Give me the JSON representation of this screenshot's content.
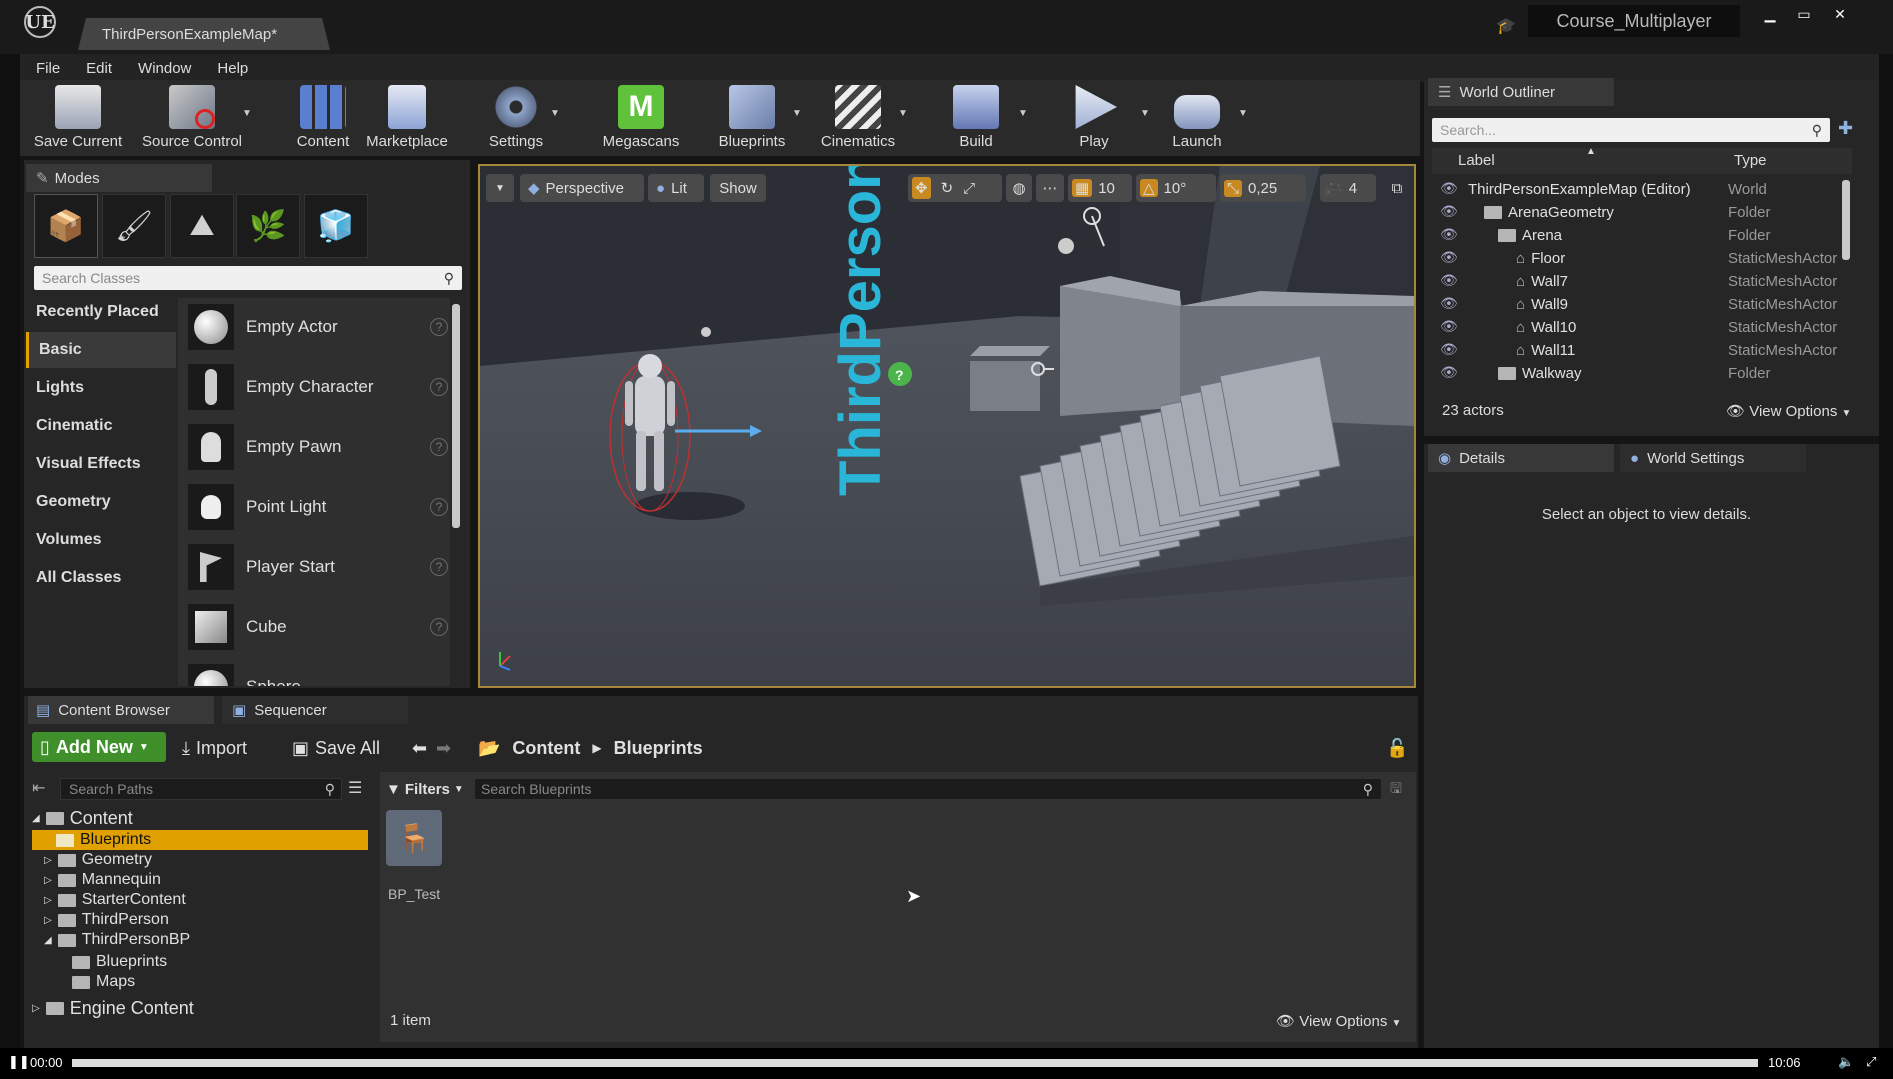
{
  "window": {
    "tab_title": "ThirdPersonExampleMap*",
    "project_name": "Course_Multiplayer",
    "logo": "UE"
  },
  "menu": [
    "File",
    "Edit",
    "Window",
    "Help"
  ],
  "toolbar": {
    "items": [
      "Save Current",
      "Source Control",
      "Content",
      "Marketplace",
      "Settings",
      "Megascans",
      "Blueprints",
      "Cinematics",
      "Build",
      "Play",
      "Launch"
    ]
  },
  "modes": {
    "tab": "Modes",
    "search_placeholder": "Search Classes",
    "categories": [
      "Recently Placed",
      "Basic",
      "Lights",
      "Cinematic",
      "Visual Effects",
      "Geometry",
      "Volumes",
      "All Classes"
    ],
    "active_category": "Basic",
    "classes": [
      "Empty Actor",
      "Empty Character",
      "Empty Pawn",
      "Point Light",
      "Player Start",
      "Cube",
      "Sphere"
    ]
  },
  "viewport": {
    "perspective": "Perspective",
    "lit": "Lit",
    "show": "Show",
    "grid_snap": "10",
    "rotation_snap": "10°",
    "scale_snap": "0,25",
    "camera_speed": "4",
    "floor_text": "ThirdPerson"
  },
  "outliner": {
    "tab": "World Outliner",
    "search_placeholder": "Search...",
    "col_label": "Label",
    "col_type": "Type",
    "rows": [
      {
        "label": "ThirdPersonExampleMap (Editor)",
        "type": "World"
      },
      {
        "label": "ArenaGeometry",
        "type": "Folder"
      },
      {
        "label": "Arena",
        "type": "Folder"
      },
      {
        "label": "Floor",
        "type": "StaticMeshActor"
      },
      {
        "label": "Wall7",
        "type": "StaticMeshActor"
      },
      {
        "label": "Wall9",
        "type": "StaticMeshActor"
      },
      {
        "label": "Wall10",
        "type": "StaticMeshActor"
      },
      {
        "label": "Wall11",
        "type": "StaticMeshActor"
      },
      {
        "label": "Walkway",
        "type": "Folder"
      }
    ],
    "actors": "23 actors",
    "view_options": "View Options"
  },
  "details": {
    "tab": "Details",
    "world_settings_tab": "World Settings",
    "message": "Select an object to view details."
  },
  "content_browser": {
    "tab": "Content Browser",
    "sequencer_tab": "Sequencer",
    "add_new": "Add New",
    "import": "Import",
    "save_all": "Save All",
    "breadcrumb": [
      "Content",
      "Blueprints"
    ],
    "search_paths_placeholder": "Search Paths",
    "filters": "Filters",
    "search_placeholder": "Search Blueprints",
    "tree": [
      {
        "label": "Content"
      },
      {
        "label": "Blueprints"
      },
      {
        "label": "Geometry"
      },
      {
        "label": "Mannequin"
      },
      {
        "label": "StarterContent"
      },
      {
        "label": "ThirdPerson"
      },
      {
        "label": "ThirdPersonBP"
      },
      {
        "label": "Blueprints"
      },
      {
        "label": "Maps"
      },
      {
        "label": "Engine Content"
      }
    ],
    "selected_folder": "Blueprints",
    "asset_name": "BP_Test",
    "items": "1 item",
    "view_options": "View Options"
  },
  "player": {
    "time_start": "00:00",
    "time_end": "10:06",
    "progress": 0.0
  }
}
